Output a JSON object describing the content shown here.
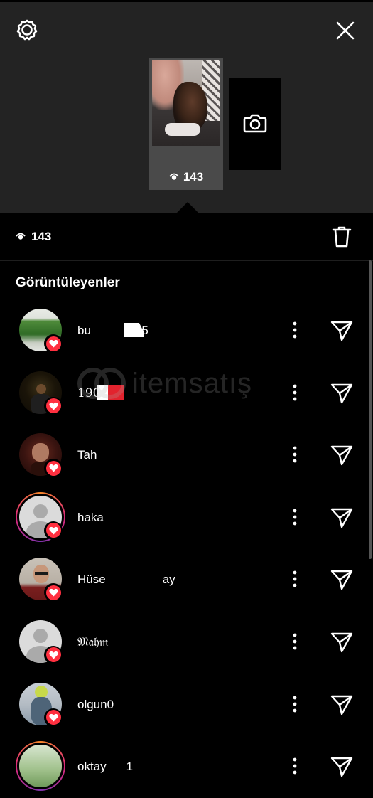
{
  "story": {
    "view_count": "143",
    "camera_icon": "camera-icon",
    "settings_icon": "settings-icon",
    "close_icon": "close-icon"
  },
  "stats": {
    "view_count": "143",
    "delete_icon": "trash-icon"
  },
  "viewers": {
    "title": "Görüntüleyenler",
    "items": [
      {
        "username": "bu",
        "suffix": "25",
        "liked": true,
        "ring": false
      },
      {
        "username": "190",
        "liked": true,
        "ring": false
      },
      {
        "username": "Tah",
        "liked": true,
        "ring": false
      },
      {
        "username": "haka",
        "liked": true,
        "ring": true
      },
      {
        "username": "Hüse",
        "suffix": "ay",
        "liked": true,
        "ring": false
      },
      {
        "username": "𝔐𝔞𝔥𝔪",
        "liked": true,
        "ring": false
      },
      {
        "username": "olgun0",
        "liked": true,
        "ring": false
      },
      {
        "username": "oktay",
        "suffix": "1",
        "liked": false,
        "ring": true
      }
    ]
  },
  "watermark": {
    "brand": "itemsatış"
  },
  "colors": {
    "like": "#ff3040",
    "background": "#000000",
    "header_bg": "#232323"
  }
}
